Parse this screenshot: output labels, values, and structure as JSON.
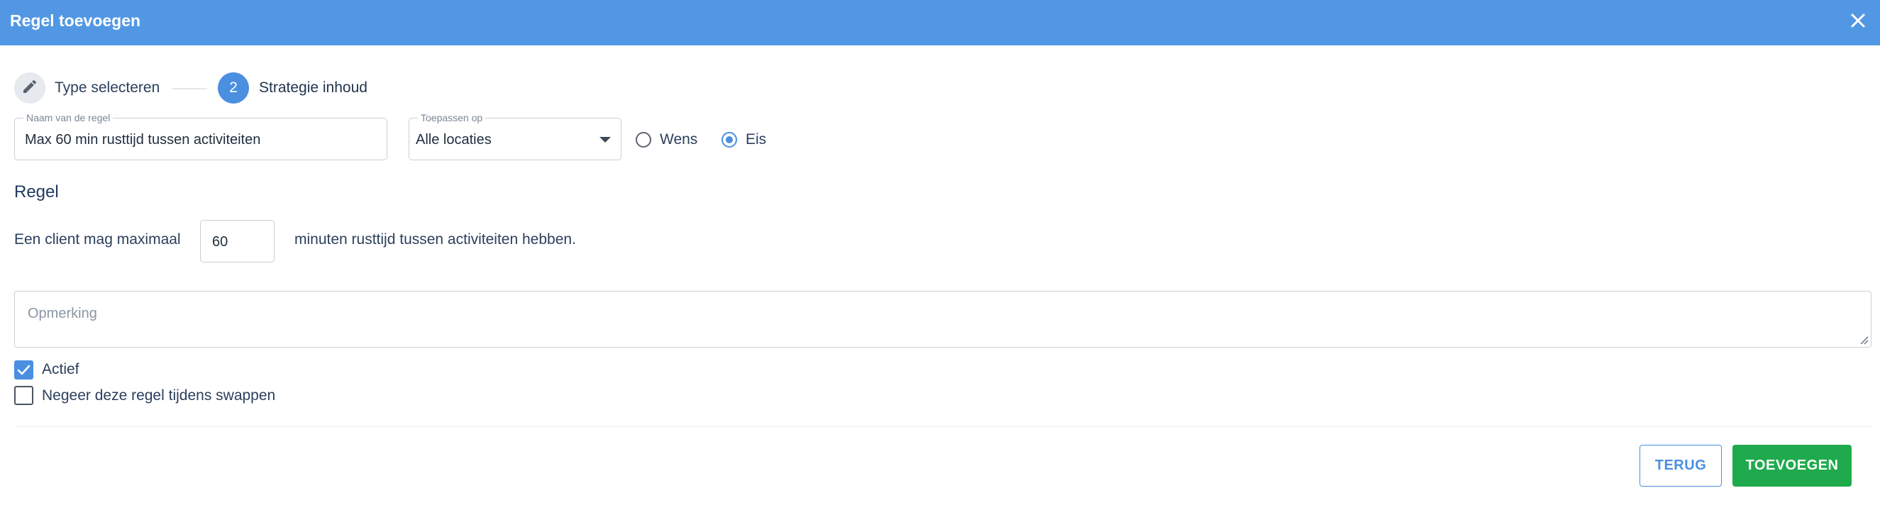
{
  "dialog": {
    "title": "Regel toevoegen"
  },
  "stepper": {
    "steps": [
      {
        "label": "Type selecteren",
        "icon": "pencil-icon",
        "state": "done"
      },
      {
        "label": "Strategie inhoud",
        "number": "2",
        "state": "active"
      }
    ]
  },
  "form": {
    "name_field": {
      "label": "Naam van de regel",
      "value": "Max 60 min rusttijd tussen activiteiten"
    },
    "apply_field": {
      "label": "Toepassen op",
      "value": "Alle locaties"
    },
    "priority": {
      "options": [
        {
          "label": "Wens",
          "checked": false
        },
        {
          "label": "Eis",
          "checked": true
        }
      ]
    },
    "section_title": "Regel",
    "rule": {
      "prefix": "Een client mag maximaal",
      "value": "60",
      "suffix": "minuten rusttijd tussen activiteiten hebben."
    },
    "remark": {
      "placeholder": "Opmerking"
    },
    "checkboxes": [
      {
        "label": "Actief",
        "checked": true
      },
      {
        "label": "Negeer deze regel tijdens swappen",
        "checked": false
      }
    ]
  },
  "actions": {
    "back_label": "TERUG",
    "add_label": "TOEVOEGEN"
  },
  "colors": {
    "header": "#5297e3",
    "accent": "#4a8fe0",
    "primary_button": "#1faa4d",
    "text": "#1f3a5f"
  }
}
